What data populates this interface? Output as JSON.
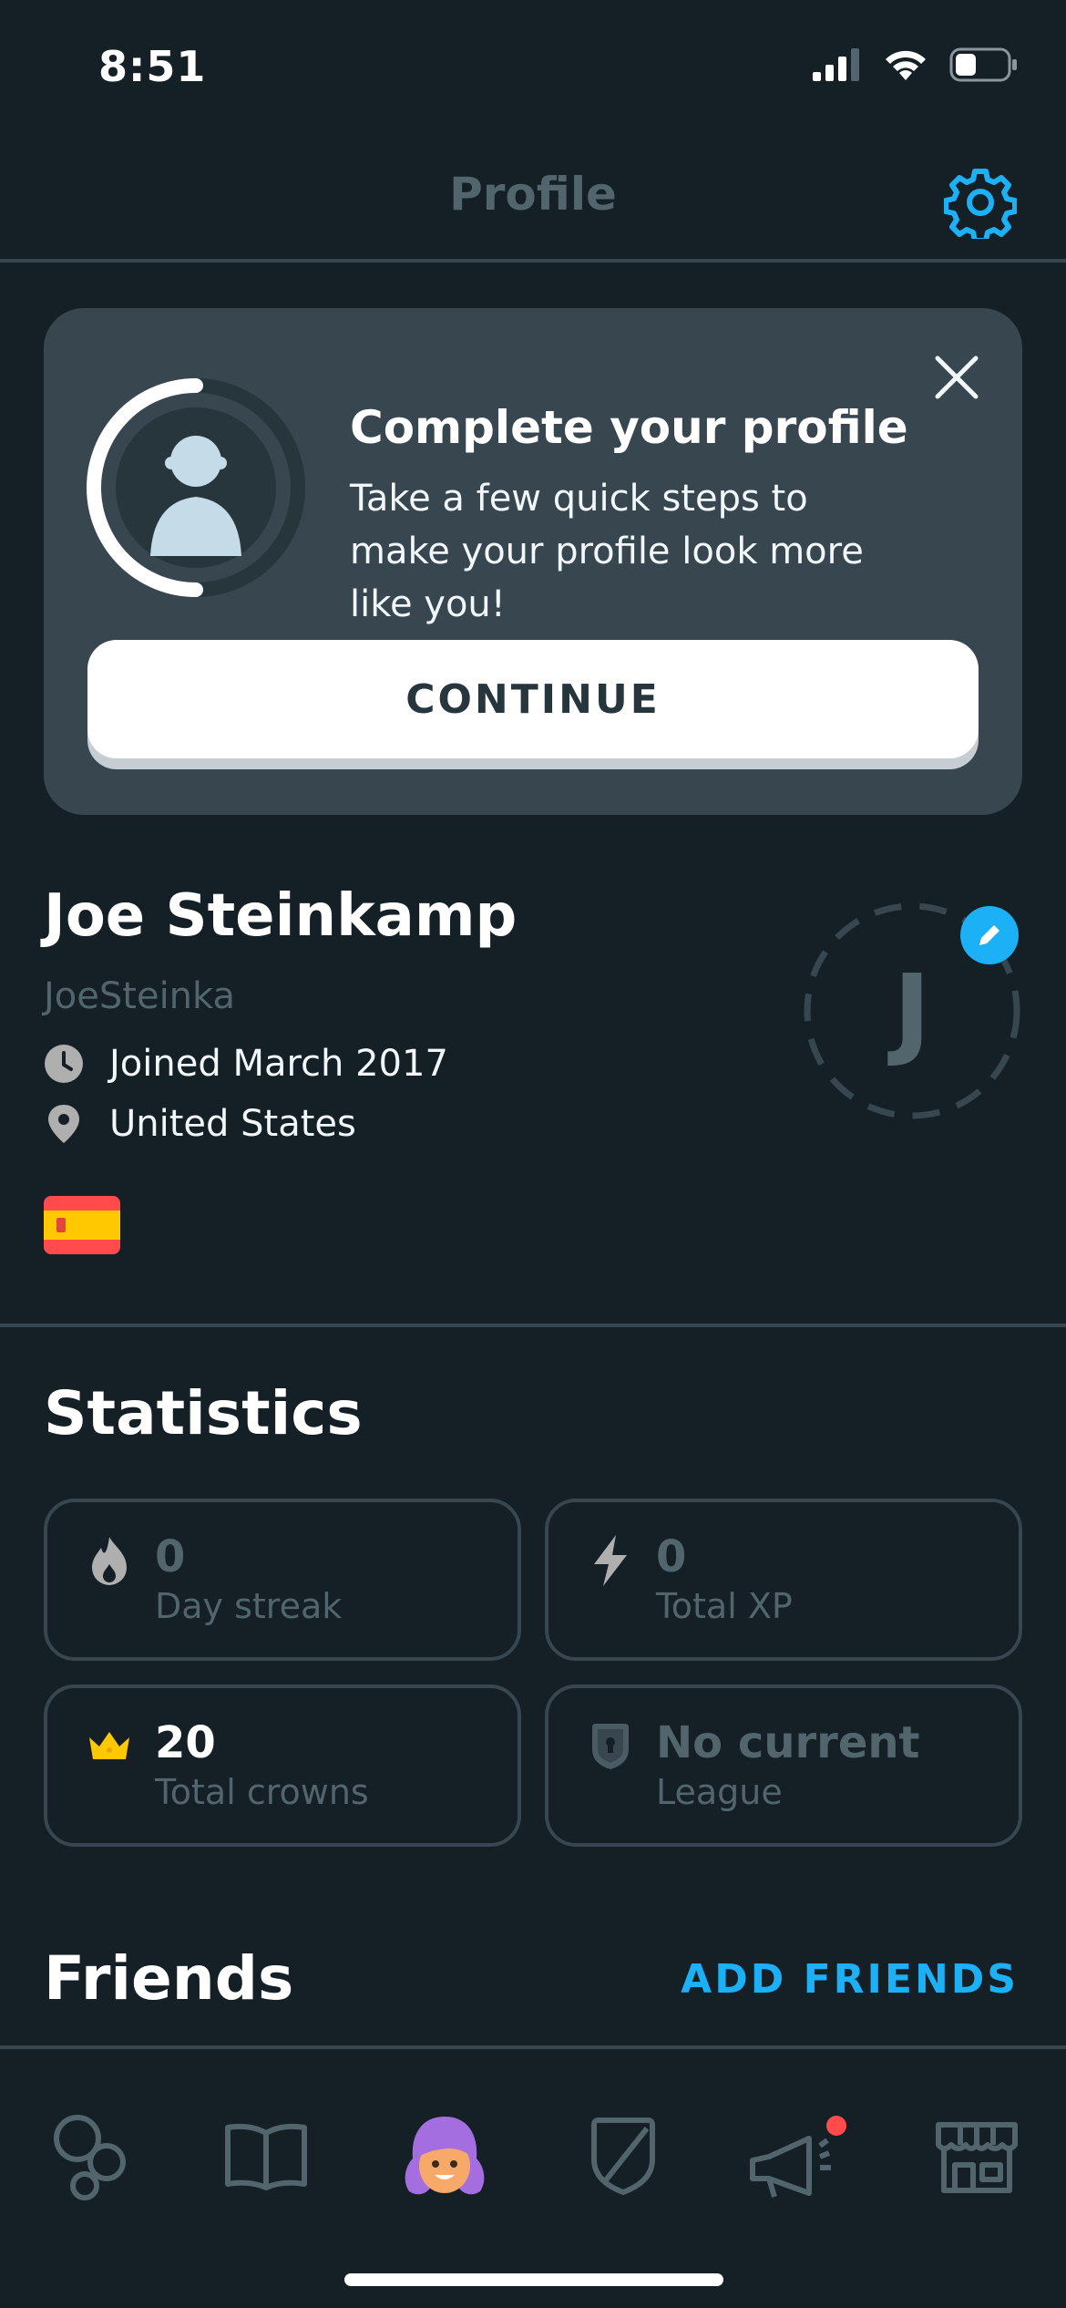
{
  "status_bar": {
    "time": "8:51"
  },
  "header": {
    "title": "Profile"
  },
  "profile_card": {
    "title": "Complete your profile",
    "description": "Take a few quick steps to make your profile look more like you!",
    "continue_label": "CONTINUE",
    "progress": 0.5
  },
  "user": {
    "name": "Joe Steinkamp",
    "username": "JoeSteinka",
    "joined": "Joined March 2017",
    "location": "United States",
    "avatar_initial": "J",
    "course_flag": "spain-flag"
  },
  "statistics": {
    "title": "Statistics",
    "items": [
      {
        "value": "0",
        "label": "Day streak",
        "icon": "flame-icon"
      },
      {
        "value": "0",
        "label": "Total XP",
        "icon": "lightning-icon"
      },
      {
        "value": "20",
        "label": "Total crowns",
        "icon": "crown-icon"
      },
      {
        "value": "No current",
        "label": "League",
        "icon": "league-shield-icon"
      }
    ]
  },
  "friends": {
    "title": "Friends",
    "add_label": "ADD FRIENDS"
  },
  "tabs": [
    "learn",
    "stories",
    "profile",
    "leaderboards",
    "news",
    "shop"
  ],
  "colors": {
    "background": "#141f26",
    "card": "#37464f",
    "accent": "#1cb0f6",
    "muted": "#52656d",
    "notification": "#ff4b4b",
    "crown": "#ffc800"
  }
}
